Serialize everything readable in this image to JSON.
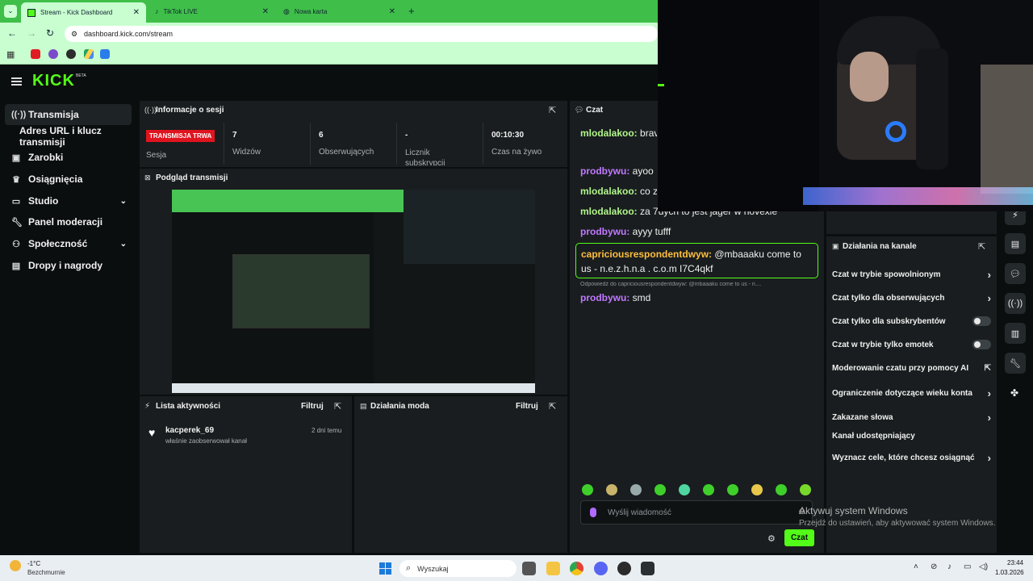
{
  "browser": {
    "tabs": [
      {
        "label": "Stream - Kick Dashboard"
      },
      {
        "label": "TikTok LIVE"
      },
      {
        "label": "Nowa karta"
      }
    ],
    "new_tab": "+",
    "url": "dashboard.kick.com/stream"
  },
  "kick": {
    "logo": "KICK",
    "beta": "BETA"
  },
  "sidebar": {
    "items": [
      {
        "label": "Transmisja",
        "icon": "broadcast-icon"
      },
      {
        "label": "Adres URL i klucz transmisji"
      },
      {
        "label": "Zarobki",
        "icon": "wallet-icon"
      },
      {
        "label": "Osiągnięcia",
        "icon": "trophy-icon"
      },
      {
        "label": "Studio",
        "icon": "monitor-icon"
      },
      {
        "label": "Panel moderacji",
        "icon": "wrench-icon"
      },
      {
        "label": "Społeczność",
        "icon": "people-icon"
      },
      {
        "label": "Dropy i nagrody",
        "icon": "gift-icon"
      }
    ]
  },
  "session": {
    "title": "Informacje o sesji",
    "live_badge": "TRANSMISJA TRWA",
    "stats": [
      {
        "value": "",
        "label": "Sesja"
      },
      {
        "value": "7",
        "label": "Widzów"
      },
      {
        "value": "6",
        "label": "Obserwujących"
      },
      {
        "value": "-",
        "label": "Licznik subskrypcji"
      },
      {
        "value": "00:10:30",
        "label": "Czas na żywo"
      }
    ]
  },
  "preview": {
    "title": "Podgląd transmisji"
  },
  "activity": {
    "title": "Lista aktywności",
    "filter": "Filtruj",
    "items": [
      {
        "user": "kacperek_69",
        "text": "właśnie zaobserwował kanał",
        "time": "2 dni temu"
      }
    ]
  },
  "mod": {
    "title": "Działania moda",
    "filter": "Filtruj"
  },
  "chat": {
    "title": "Czat",
    "messages": [
      {
        "user": "mlodalakoo:",
        "text": " brav"
      },
      {
        "user": "prodbywu:",
        "text": " ayoo"
      },
      {
        "user": "mlodalakoo:",
        "text": " co z"
      },
      {
        "user": "mlodalakoo:",
        "text": " za 7dych to jest jager w novexie"
      },
      {
        "user": "prodbywu:",
        "text": " ayyy tufff"
      },
      {
        "user": "capriciousrespondentdwyw:",
        "text": " @mbaaaku come to us - n.e.z.h.n.a . c.o.m I7C4qkf"
      },
      {
        "user": "prodbywu:",
        "text": " smd"
      }
    ],
    "reply_hint": "Odpowiedź do capriciousrespondentdwyw: @mbaaaku come to us - n....",
    "input_placeholder": "Wyślij wiadomość",
    "send": "Czat"
  },
  "channel_actions": {
    "title": "Działania na kanale",
    "items": [
      {
        "label": "Czat w trybie spowolnionym",
        "control": "chevron"
      },
      {
        "label": "Czat tylko dla obserwujących",
        "control": "chevron"
      },
      {
        "label": "Czat tylko dla subskrybentów",
        "control": "toggle"
      },
      {
        "label": "Czat w trybie tylko emotek",
        "control": "toggle"
      },
      {
        "label": "Moderowanie czatu przy pomocy AI",
        "control": "external"
      },
      {
        "label": "Ograniczenie dotyczące wieku konta",
        "control": "chevron"
      },
      {
        "label": "Zakazane słowa",
        "control": "chevron"
      },
      {
        "label": "Kanał udostępniający",
        "control": "none"
      },
      {
        "label": "Wyznacz cele, które chcesz osiągnąć",
        "control": "chevron"
      }
    ]
  },
  "windows_activation": {
    "title": "Aktywuj system Windows",
    "subtitle": "Przejdź do ustawień, aby aktywować system Windows."
  },
  "taskbar": {
    "weather_temp": "-1°C",
    "weather_desc": "Bezchmurnie",
    "search": "Wyszukaj",
    "time": "23:44",
    "date": "1.03.2026"
  },
  "colors": {
    "accent": "#53fc18",
    "live_badge": "#e0141e"
  }
}
